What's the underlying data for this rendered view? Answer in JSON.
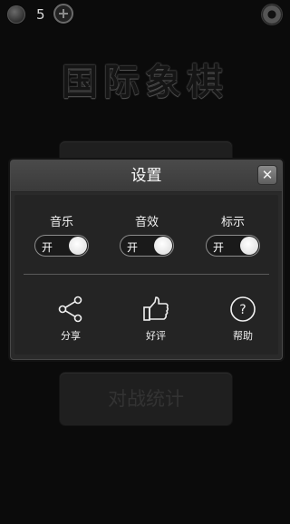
{
  "topbar": {
    "coin_count": "5"
  },
  "app_title": "国际象棋",
  "bottom_button": {
    "label": "对战统计"
  },
  "dialog": {
    "title": "设置",
    "close_icon": "✕",
    "toggles": [
      {
        "label": "音乐",
        "state": "开"
      },
      {
        "label": "音效",
        "state": "开"
      },
      {
        "label": "标示",
        "state": "开"
      }
    ],
    "actions": [
      {
        "label": "分享",
        "icon": "share-icon"
      },
      {
        "label": "好评",
        "icon": "thumbs-up-icon"
      },
      {
        "label": "帮助",
        "icon": "help-icon"
      }
    ]
  },
  "colors": {
    "background": "#0b0b0b",
    "dialog_header": "#404040",
    "dialog_body": "#242424"
  }
}
